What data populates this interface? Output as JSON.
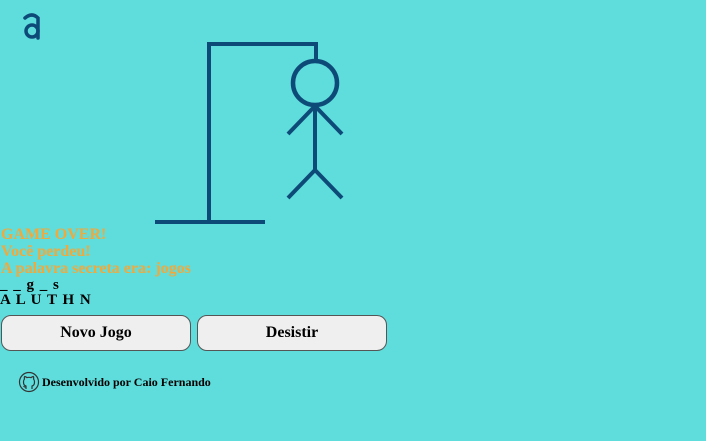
{
  "game": {
    "status": "GAME OVER!",
    "result": "Você perdeu!",
    "secret_word_message": "A palavra secreta era: jogos",
    "word_progress": "_ _ g _ s",
    "wrong_letters": "A L U T H N"
  },
  "buttons": {
    "new_game": "Novo Jogo",
    "give_up": "Desistir"
  },
  "footer": {
    "credit": "Desenvolvido por Caio Fernando",
    "icon": "github-icon"
  },
  "colors": {
    "background": "#5fdcdc",
    "drawing": "#0d4a78",
    "message": "#f2a93b"
  }
}
